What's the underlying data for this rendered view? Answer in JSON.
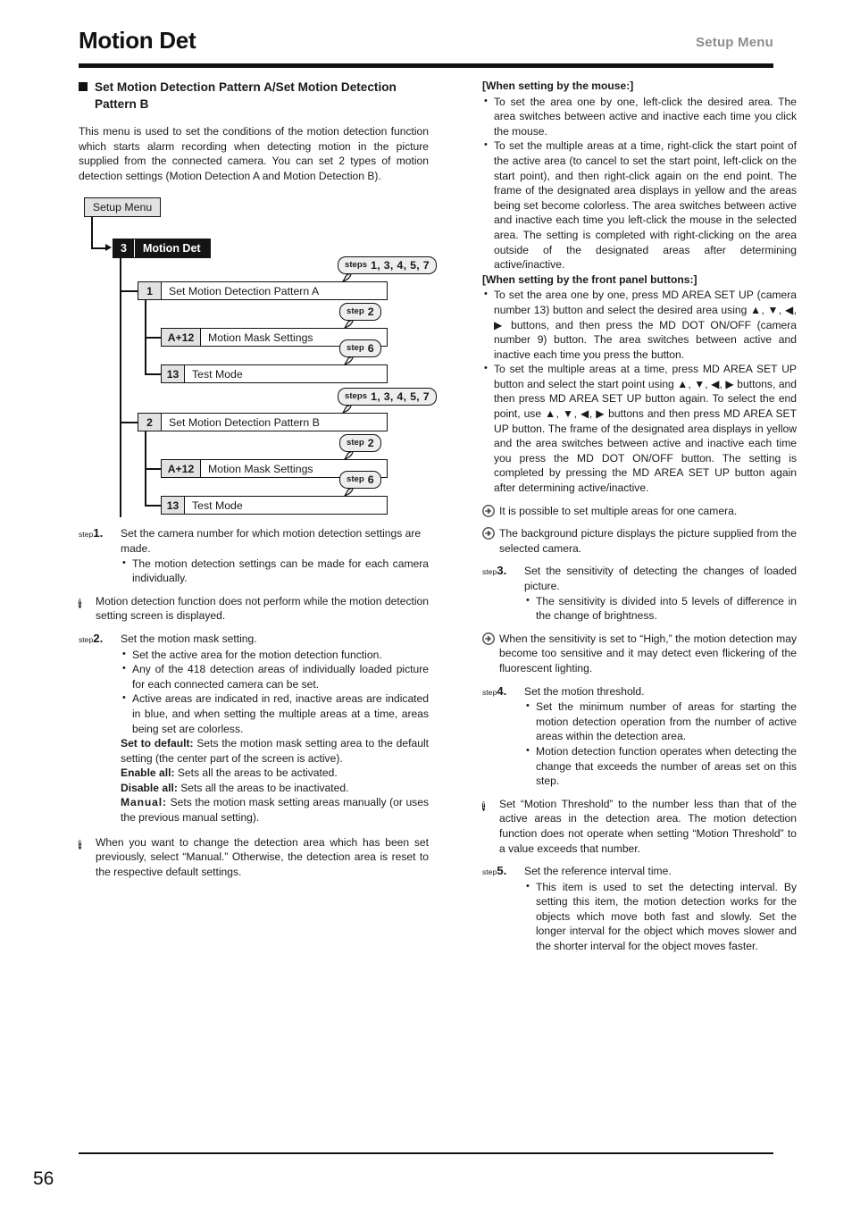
{
  "header": {
    "title": "Motion Det",
    "right_label": "Setup Menu"
  },
  "left_column": {
    "section_heading": "Set Motion Detection Pattern A/Set Motion Detection Pattern B",
    "intro": "This menu is used to set the conditions of the motion detection function which starts alarm recording when detecting motion in the picture supplied from the connected camera. You can set 2 types of motion detection settings (Motion Detection A and Motion Detection B).",
    "steps": [
      {
        "tag_small": "step",
        "tag_num": "1.",
        "lead": "Set the camera number for which motion detection settings are made.",
        "bullets": [
          "The motion detection settings can be made for each camera individually."
        ]
      },
      {
        "tag_small": "step",
        "tag_num": "2.",
        "lead": "Set the motion mask setting.",
        "bullets": [
          "Set the active area for the motion detection function.",
          "Any of the 418 detection areas of individually loaded picture for each connected camera can be set.",
          "Active areas are indicated in red, inactive areas are indicated in blue, and when setting the multiple areas at a time, areas being set are colorless."
        ]
      }
    ],
    "note_after_step1": "Motion detection function does not perform while the motion detection setting screen is displayed.",
    "definitions": [
      {
        "term": "Set to default:",
        "text": " Sets the motion mask setting area to the default setting (the center part of the screen is active)."
      },
      {
        "term": "Enable all:",
        "text": " Sets all the areas to be activated."
      },
      {
        "term": "Disable all:",
        "text": " Sets all the areas to be inactivated."
      },
      {
        "term": "Manual:",
        "text": " Sets the motion mask setting areas manually (or uses the previous manual setting)."
      }
    ],
    "note_after_step2": "When you want to change the detection area which has been set previously, select “Manual.” Otherwise, the detection area is reset to the respective default settings."
  },
  "diagram": {
    "setup_menu": "Setup Menu",
    "root": {
      "key": "3",
      "label": "Motion Det"
    },
    "groups": [
      {
        "main": {
          "key": "1",
          "label": "Set Motion Detection Pattern A",
          "callout_word": "steps",
          "callout_nums": "1, 3, 4, 5, 7"
        },
        "children": [
          {
            "key": "A+12",
            "label": "Motion Mask Settings",
            "callout_word": "step",
            "callout_nums": "2"
          },
          {
            "key": "13",
            "label": "Test Mode",
            "callout_word": "step",
            "callout_nums": "6"
          }
        ]
      },
      {
        "main": {
          "key": "2",
          "label": "Set Motion Detection Pattern B",
          "callout_word": "steps",
          "callout_nums": "1, 3, 4, 5, 7"
        },
        "children": [
          {
            "key": "A+12",
            "label": "Motion Mask Settings",
            "callout_word": "step",
            "callout_nums": "2"
          },
          {
            "key": "13",
            "label": "Test Mode",
            "callout_word": "step",
            "callout_nums": "6"
          }
        ]
      }
    ]
  },
  "right_column": {
    "mouse_heading": "[When setting by the mouse:]",
    "mouse_bullets": [
      "To set the area one by one, left-click the desired area. The area switches between active and inactive each time you click the mouse.",
      "To set the multiple areas at a time, right-click the start point of the active area (to cancel to set the start point, left-click on the start point), and then right-click again on the end point. The frame of the designated area displays in yellow and the areas being set become colorless. The area switches between active and inactive each time you left-click the mouse in the selected area. The setting is completed with right-clicking on the area outside of the designated areas after determining active/inactive."
    ],
    "panel_heading": "[When setting by the front panel buttons:]",
    "panel_bullets": [
      "To set the area one by one, press MD AREA SET UP (camera number 13) button and select the desired area using ▲, ▼, ◀, ▶ buttons, and then press the MD DOT ON/OFF (camera number 9) button. The area switches between active and inactive each time you press the button.",
      "To set the multiple areas at a time, press MD AREA SET UP button and select the start point using ▲, ▼, ◀, ▶ buttons, and then press MD AREA SET UP button again. To select the end point, use ▲, ▼, ◀, ▶ buttons and then press MD AREA SET UP button. The frame of the designated area displays in yellow and the area switches between active and inactive each time you press the MD DOT ON/OFF button. The setting is completed by pressing the MD AREA SET UP button again after determining active/inactive."
    ],
    "arrow_notes": [
      "It is possible to set multiple areas for one camera.",
      "The background picture displays the picture supplied from the selected camera."
    ],
    "steps": [
      {
        "tag_small": "step",
        "tag_num": "3.",
        "lead": "Set the sensitivity of detecting the changes of loaded picture.",
        "bullets": [
          "The sensitivity is divided into 5 levels of difference in the change of brightness."
        ]
      },
      {
        "tag_small": "step",
        "tag_num": "4.",
        "lead": "Set the motion threshold.",
        "bullets": [
          "Set the minimum number of areas for starting the motion detection operation from the number of active areas within the detection area.",
          "Motion detection function operates when detecting the change that exceeds the number of areas set on this step."
        ]
      },
      {
        "tag_small": "step",
        "tag_num": "5.",
        "lead": "Set the reference interval time.",
        "bullets": [
          "This item is used to set the detecting interval. By setting this item, the motion detection works for the objects which move both fast and slowly. Set the longer interval for the object which moves slower and the shorter interval for the object moves faster."
        ]
      }
    ],
    "arrow_note_sensitivity": "When the sensitivity is set to “High,” the motion detection may become too sensitive and it may detect even flickering of the fluorescent lighting.",
    "note_threshold": "Set “Motion Threshold” to the number less than that of the active areas in the detection area. The motion detection function does not operate when setting “Motion Threshold” to a value exceeds that number."
  },
  "footer": {
    "page_number": "56"
  }
}
